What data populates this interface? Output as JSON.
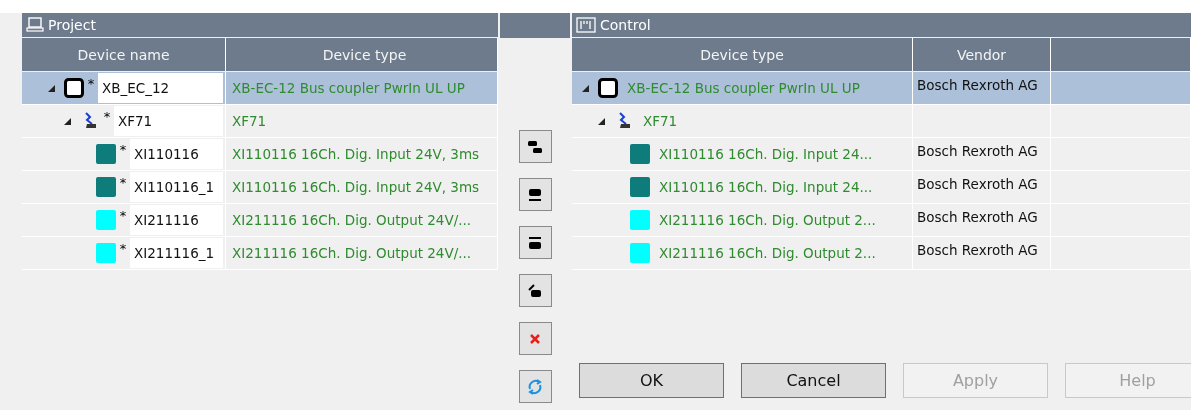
{
  "project": {
    "title": "Project",
    "columns": [
      "Device name",
      "Device type"
    ],
    "tree": [
      {
        "kind": "coupler",
        "marker": "*",
        "name": "XB_EC_12",
        "type": "XB-EC-12 Bus coupler PwrIn UL UP",
        "selected": true,
        "expanded": true,
        "children": [
          {
            "kind": "bus",
            "marker": "*",
            "name": "XF71",
            "type": "XF71",
            "selected": false,
            "expanded": true,
            "children": [
              {
                "kind": "module",
                "color": "#0e7c7b",
                "marker": "*",
                "name": "XI110116",
                "type": "XI110116 16Ch. Dig. Input 24V, 3ms",
                "selected": false
              },
              {
                "kind": "module",
                "color": "#0e7c7b",
                "marker": "*",
                "name": "XI110116_1",
                "type": "XI110116 16Ch. Dig. Input 24V, 3ms",
                "selected": false
              },
              {
                "kind": "module",
                "color": "#00ffff",
                "marker": "*",
                "name": "XI211116",
                "type": "XI211116 16Ch. Dig. Output 24V/...",
                "selected": false
              },
              {
                "kind": "module",
                "color": "#00ffff",
                "marker": "*",
                "name": "XI211116_1",
                "type": "XI211116 16Ch. Dig. Output 24V/...",
                "selected": false
              }
            ]
          }
        ]
      }
    ]
  },
  "control": {
    "title": "Control",
    "columns": [
      "Device type",
      "Vendor"
    ],
    "tree": [
      {
        "kind": "coupler",
        "type": "XB-EC-12 Bus coupler PwrIn UL UP",
        "vendor": "Bosch Rexroth AG",
        "selected": true,
        "expanded": true,
        "children": [
          {
            "kind": "bus",
            "type": "XF71",
            "selected": false,
            "expanded": true,
            "children": [
              {
                "kind": "module",
                "color": "#0e7c7b",
                "type": "XI110116 16Ch. Dig. Input 24...",
                "vendor": "Bosch Rexroth AG",
                "selected": false
              },
              {
                "kind": "module",
                "color": "#0e7c7b",
                "type": "XI110116 16Ch. Dig. Input 24...",
                "vendor": "Bosch Rexroth AG",
                "selected": false
              },
              {
                "kind": "module",
                "color": "#00ffff",
                "type": "XI211116 16Ch. Dig. Output 2...",
                "vendor": "Bosch Rexroth AG",
                "selected": false
              },
              {
                "kind": "module",
                "color": "#00ffff",
                "type": "XI211116 16Ch. Dig. Output 2...",
                "vendor": "Bosch Rexroth AG",
                "selected": false
              }
            ]
          }
        ]
      }
    ]
  },
  "buttons": [
    {
      "label": "OK",
      "disabled": false
    },
    {
      "label": "Cancel",
      "disabled": false
    },
    {
      "label": "Apply",
      "disabled": true
    },
    {
      "label": "Help",
      "disabled": true
    }
  ]
}
